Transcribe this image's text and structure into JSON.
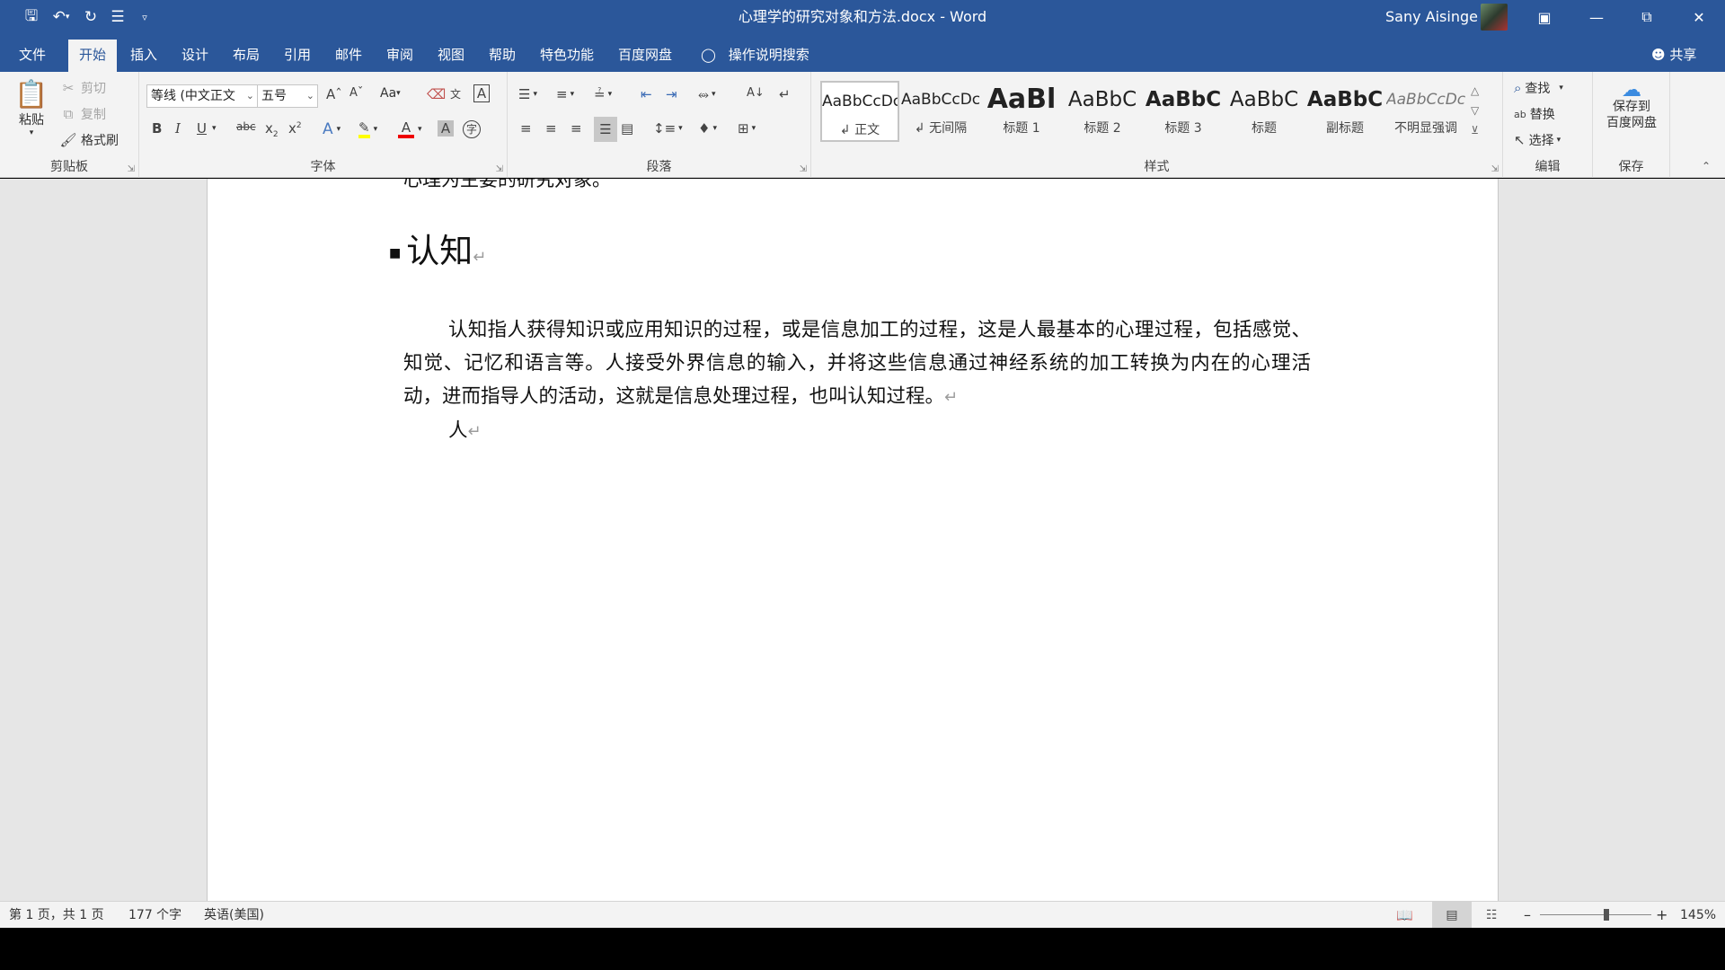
{
  "titlebar": {
    "doc_title": "心理学的研究对象和方法.docx  -  Word",
    "user_name": "Sany Aisinge",
    "quick_access": [
      "save-icon",
      "undo-icon",
      "redo-icon",
      "touch-mode-icon",
      "customize-icon"
    ]
  },
  "tabs": [
    "文件",
    "开始",
    "插入",
    "设计",
    "布局",
    "引用",
    "邮件",
    "审阅",
    "视图",
    "帮助",
    "特色功能",
    "百度网盘"
  ],
  "tell_me": "操作说明搜索",
  "share": "共享",
  "ribbon": {
    "clipboard": {
      "label": "剪贴板",
      "paste": "粘贴",
      "cut": "剪切",
      "copy": "复制",
      "format_painter": "格式刷"
    },
    "font": {
      "label": "字体",
      "font_name": "等线 (中文正文",
      "font_size": "五号",
      "change_case": "Aa"
    },
    "paragraph": {
      "label": "段落"
    },
    "styles": {
      "label": "样式",
      "items": [
        {
          "preview": "AaBbCcDc",
          "name": "↲ 正文"
        },
        {
          "preview": "AaBbCcDc",
          "name": "↲ 无间隔"
        },
        {
          "preview": "AaBl",
          "name": "标题 1"
        },
        {
          "preview": "AaBbC",
          "name": "标题 2"
        },
        {
          "preview": "AaBbC",
          "name": "标题 3"
        },
        {
          "preview": "AaBbC",
          "name": "标题"
        },
        {
          "preview": "AaBbC",
          "name": "副标题"
        },
        {
          "preview": "AaBbCcDc",
          "name": "不明显强调"
        }
      ]
    },
    "editing": {
      "label": "编辑",
      "find": "查找",
      "replace": "替换",
      "select": "选择"
    },
    "save": {
      "label": "保存",
      "button_line1": "保存到",
      "button_line2": "百度网盘"
    }
  },
  "document": {
    "prev_line": "心理为主要的研究对象。",
    "heading": "认知",
    "body": "认知指人获得知识或应用知识的过程，或是信息加工的过程，这是人最基本的心理过程，包括感觉、知觉、记忆和语言等。人接受外界信息的输入，并将这些信息通过神经系统的加工转换为内在的心理活动，进而指导人的活动，这就是信息处理过程，也叫认知过程。",
    "last_line": "人",
    "para_mark": "↵"
  },
  "status": {
    "page": "第 1 页，共 1 页",
    "words": "177 个字",
    "language": "英语(美国)",
    "zoom": "145%",
    "zoom_level": 0.6
  }
}
